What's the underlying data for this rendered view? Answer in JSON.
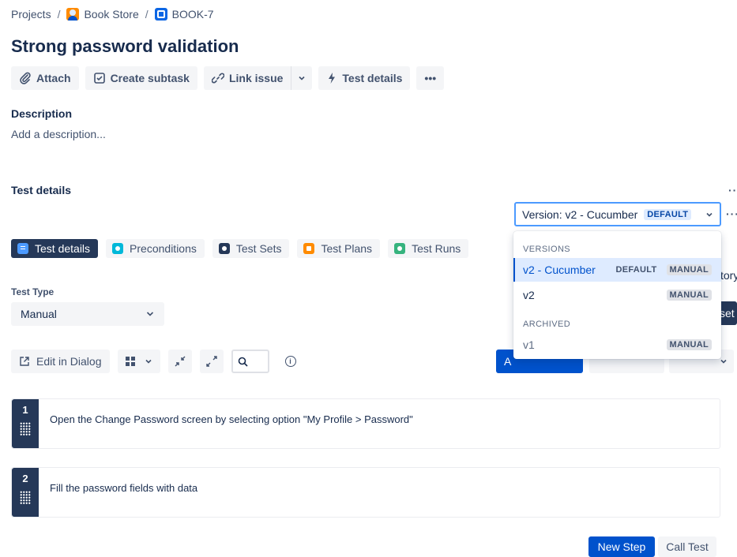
{
  "breadcrumb": {
    "projects": "Projects",
    "project": "Book Store",
    "issue_key": "BOOK-7",
    "separator": "/"
  },
  "issue": {
    "title": "Strong password validation"
  },
  "actions": {
    "attach": "Attach",
    "create_subtask": "Create subtask",
    "link_issue": "Link issue",
    "test_details": "Test details",
    "more": "•••"
  },
  "description": {
    "heading": "Description",
    "placeholder": "Add a description..."
  },
  "test_details_panel": {
    "heading": "Test details",
    "header_more": "··",
    "version_select": {
      "label": "Version: v2 - Cucumber",
      "badge": "DEFAULT",
      "more": "···"
    },
    "tabs": [
      {
        "label": "Test details",
        "icon": "list-icon",
        "active": true
      },
      {
        "label": "Preconditions",
        "icon": "preconditions-icon",
        "active": false
      },
      {
        "label": "Test Sets",
        "icon": "test-sets-icon",
        "active": false
      },
      {
        "label": "Test Plans",
        "icon": "test-plans-icon",
        "active": false
      },
      {
        "label": "Test Runs",
        "icon": "test-runs-icon",
        "active": false
      }
    ],
    "behind_dropdown": {
      "history_fragment": "tory",
      "reset_fragment": "set",
      "add_fragment": "A"
    },
    "test_type": {
      "label": "Test Type",
      "value": "Manual"
    },
    "toolbar": {
      "edit_in_dialog": "Edit in Dialog"
    },
    "steps": [
      {
        "number": "1",
        "action": "Open the Change Password screen by selecting option \"My Profile > Password\""
      },
      {
        "number": "2",
        "action": "Fill the password fields with data"
      }
    ],
    "footer": {
      "new_step": "New Step",
      "call_test": "Call Test"
    }
  },
  "version_dropdown": {
    "groups": [
      {
        "label": "VERSIONS",
        "options": [
          {
            "name": "v2 - Cucumber",
            "tags": [
              "DEFAULT",
              "MANUAL"
            ],
            "selected": true
          },
          {
            "name": "v2",
            "tags": [
              "MANUAL"
            ],
            "selected": false
          }
        ]
      },
      {
        "label": "ARCHIVED",
        "options": [
          {
            "name": "v1",
            "tags": [
              "MANUAL"
            ],
            "selected": false
          }
        ]
      }
    ]
  },
  "colors": {
    "primary": "#0052cc",
    "dark_navy": "#253858",
    "focus_border": "#4c9aff",
    "selected_bg": "#deebff"
  }
}
